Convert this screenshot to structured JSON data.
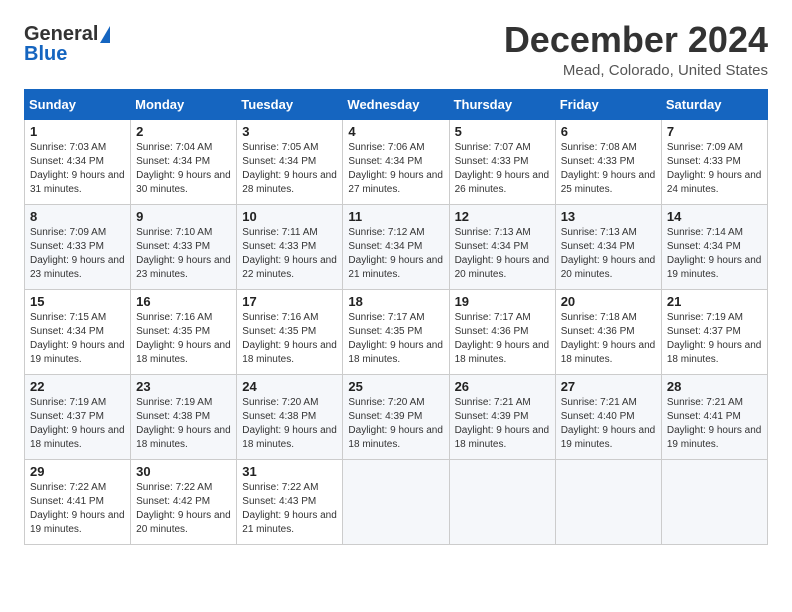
{
  "header": {
    "logo_general": "General",
    "logo_blue": "Blue",
    "month": "December 2024",
    "location": "Mead, Colorado, United States"
  },
  "days_of_week": [
    "Sunday",
    "Monday",
    "Tuesday",
    "Wednesday",
    "Thursday",
    "Friday",
    "Saturday"
  ],
  "weeks": [
    [
      {
        "day": "1",
        "sunrise": "Sunrise: 7:03 AM",
        "sunset": "Sunset: 4:34 PM",
        "daylight": "Daylight: 9 hours and 31 minutes."
      },
      {
        "day": "2",
        "sunrise": "Sunrise: 7:04 AM",
        "sunset": "Sunset: 4:34 PM",
        "daylight": "Daylight: 9 hours and 30 minutes."
      },
      {
        "day": "3",
        "sunrise": "Sunrise: 7:05 AM",
        "sunset": "Sunset: 4:34 PM",
        "daylight": "Daylight: 9 hours and 28 minutes."
      },
      {
        "day": "4",
        "sunrise": "Sunrise: 7:06 AM",
        "sunset": "Sunset: 4:34 PM",
        "daylight": "Daylight: 9 hours and 27 minutes."
      },
      {
        "day": "5",
        "sunrise": "Sunrise: 7:07 AM",
        "sunset": "Sunset: 4:33 PM",
        "daylight": "Daylight: 9 hours and 26 minutes."
      },
      {
        "day": "6",
        "sunrise": "Sunrise: 7:08 AM",
        "sunset": "Sunset: 4:33 PM",
        "daylight": "Daylight: 9 hours and 25 minutes."
      },
      {
        "day": "7",
        "sunrise": "Sunrise: 7:09 AM",
        "sunset": "Sunset: 4:33 PM",
        "daylight": "Daylight: 9 hours and 24 minutes."
      }
    ],
    [
      {
        "day": "8",
        "sunrise": "Sunrise: 7:09 AM",
        "sunset": "Sunset: 4:33 PM",
        "daylight": "Daylight: 9 hours and 23 minutes."
      },
      {
        "day": "9",
        "sunrise": "Sunrise: 7:10 AM",
        "sunset": "Sunset: 4:33 PM",
        "daylight": "Daylight: 9 hours and 23 minutes."
      },
      {
        "day": "10",
        "sunrise": "Sunrise: 7:11 AM",
        "sunset": "Sunset: 4:33 PM",
        "daylight": "Daylight: 9 hours and 22 minutes."
      },
      {
        "day": "11",
        "sunrise": "Sunrise: 7:12 AM",
        "sunset": "Sunset: 4:34 PM",
        "daylight": "Daylight: 9 hours and 21 minutes."
      },
      {
        "day": "12",
        "sunrise": "Sunrise: 7:13 AM",
        "sunset": "Sunset: 4:34 PM",
        "daylight": "Daylight: 9 hours and 20 minutes."
      },
      {
        "day": "13",
        "sunrise": "Sunrise: 7:13 AM",
        "sunset": "Sunset: 4:34 PM",
        "daylight": "Daylight: 9 hours and 20 minutes."
      },
      {
        "day": "14",
        "sunrise": "Sunrise: 7:14 AM",
        "sunset": "Sunset: 4:34 PM",
        "daylight": "Daylight: 9 hours and 19 minutes."
      }
    ],
    [
      {
        "day": "15",
        "sunrise": "Sunrise: 7:15 AM",
        "sunset": "Sunset: 4:34 PM",
        "daylight": "Daylight: 9 hours and 19 minutes."
      },
      {
        "day": "16",
        "sunrise": "Sunrise: 7:16 AM",
        "sunset": "Sunset: 4:35 PM",
        "daylight": "Daylight: 9 hours and 18 minutes."
      },
      {
        "day": "17",
        "sunrise": "Sunrise: 7:16 AM",
        "sunset": "Sunset: 4:35 PM",
        "daylight": "Daylight: 9 hours and 18 minutes."
      },
      {
        "day": "18",
        "sunrise": "Sunrise: 7:17 AM",
        "sunset": "Sunset: 4:35 PM",
        "daylight": "Daylight: 9 hours and 18 minutes."
      },
      {
        "day": "19",
        "sunrise": "Sunrise: 7:17 AM",
        "sunset": "Sunset: 4:36 PM",
        "daylight": "Daylight: 9 hours and 18 minutes."
      },
      {
        "day": "20",
        "sunrise": "Sunrise: 7:18 AM",
        "sunset": "Sunset: 4:36 PM",
        "daylight": "Daylight: 9 hours and 18 minutes."
      },
      {
        "day": "21",
        "sunrise": "Sunrise: 7:19 AM",
        "sunset": "Sunset: 4:37 PM",
        "daylight": "Daylight: 9 hours and 18 minutes."
      }
    ],
    [
      {
        "day": "22",
        "sunrise": "Sunrise: 7:19 AM",
        "sunset": "Sunset: 4:37 PM",
        "daylight": "Daylight: 9 hours and 18 minutes."
      },
      {
        "day": "23",
        "sunrise": "Sunrise: 7:19 AM",
        "sunset": "Sunset: 4:38 PM",
        "daylight": "Daylight: 9 hours and 18 minutes."
      },
      {
        "day": "24",
        "sunrise": "Sunrise: 7:20 AM",
        "sunset": "Sunset: 4:38 PM",
        "daylight": "Daylight: 9 hours and 18 minutes."
      },
      {
        "day": "25",
        "sunrise": "Sunrise: 7:20 AM",
        "sunset": "Sunset: 4:39 PM",
        "daylight": "Daylight: 9 hours and 18 minutes."
      },
      {
        "day": "26",
        "sunrise": "Sunrise: 7:21 AM",
        "sunset": "Sunset: 4:39 PM",
        "daylight": "Daylight: 9 hours and 18 minutes."
      },
      {
        "day": "27",
        "sunrise": "Sunrise: 7:21 AM",
        "sunset": "Sunset: 4:40 PM",
        "daylight": "Daylight: 9 hours and 19 minutes."
      },
      {
        "day": "28",
        "sunrise": "Sunrise: 7:21 AM",
        "sunset": "Sunset: 4:41 PM",
        "daylight": "Daylight: 9 hours and 19 minutes."
      }
    ],
    [
      {
        "day": "29",
        "sunrise": "Sunrise: 7:22 AM",
        "sunset": "Sunset: 4:41 PM",
        "daylight": "Daylight: 9 hours and 19 minutes."
      },
      {
        "day": "30",
        "sunrise": "Sunrise: 7:22 AM",
        "sunset": "Sunset: 4:42 PM",
        "daylight": "Daylight: 9 hours and 20 minutes."
      },
      {
        "day": "31",
        "sunrise": "Sunrise: 7:22 AM",
        "sunset": "Sunset: 4:43 PM",
        "daylight": "Daylight: 9 hours and 21 minutes."
      },
      null,
      null,
      null,
      null
    ]
  ]
}
